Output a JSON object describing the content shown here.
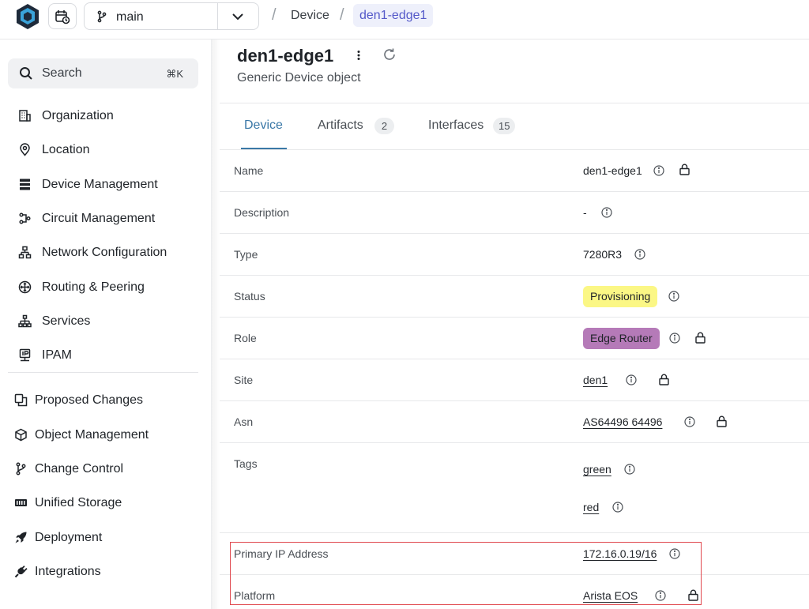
{
  "topbar": {
    "branch": "main",
    "breadcrumb": [
      "Device",
      "den1-edge1"
    ]
  },
  "sidebar": {
    "search": {
      "label": "Search",
      "shortcut": "⌘K"
    },
    "primary_items": [
      {
        "label": "Organization",
        "icon": "building-icon"
      },
      {
        "label": "Location",
        "icon": "map-pin-icon"
      },
      {
        "label": "Device Management",
        "icon": "server-icon"
      },
      {
        "label": "Circuit Management",
        "icon": "circuit-icon"
      },
      {
        "label": "Network Configuration",
        "icon": "network-icon"
      },
      {
        "label": "Routing & Peering",
        "icon": "routing-icon"
      },
      {
        "label": "Services",
        "icon": "sitemap-icon"
      },
      {
        "label": "IPAM",
        "icon": "ipam-icon"
      }
    ],
    "secondary_items": [
      {
        "label": "Proposed Changes",
        "icon": "copy-icon"
      },
      {
        "label": "Object Management",
        "icon": "cube-icon"
      },
      {
        "label": "Change Control",
        "icon": "branch-icon"
      },
      {
        "label": "Unified Storage",
        "icon": "storage-icon"
      },
      {
        "label": "Deployment",
        "icon": "rocket-icon"
      },
      {
        "label": "Integrations",
        "icon": "plug-icon"
      }
    ]
  },
  "object": {
    "title": "den1-edge1",
    "subtitle": "Generic Device object"
  },
  "tabs": [
    {
      "label": "Device",
      "count": null,
      "active": true
    },
    {
      "label": "Artifacts",
      "count": "2",
      "active": false
    },
    {
      "label": "Interfaces",
      "count": "15",
      "active": false
    }
  ],
  "fields": {
    "name": {
      "label": "Name",
      "value": "den1-edge1"
    },
    "description": {
      "label": "Description",
      "value": "-"
    },
    "type": {
      "label": "Type",
      "value": "7280R3"
    },
    "status": {
      "label": "Status",
      "value": "Provisioning"
    },
    "role": {
      "label": "Role",
      "value": "Edge Router"
    },
    "site": {
      "label": "Site",
      "value": "den1"
    },
    "asn": {
      "label": "Asn",
      "value": "AS64496 64496"
    },
    "tags": {
      "label": "Tags",
      "values": [
        "green",
        "red"
      ]
    },
    "primary_ip": {
      "label": "Primary IP Address",
      "value": "172.16.0.19/16"
    },
    "platform": {
      "label": "Platform",
      "value": "Arista EOS"
    }
  },
  "colors": {
    "accent": "#3a78a7",
    "breadcrumb_active": "#5459c9",
    "status_badge": "#fbf785",
    "role_badge": "#b57ab8",
    "highlight_box": "#e0484e"
  }
}
